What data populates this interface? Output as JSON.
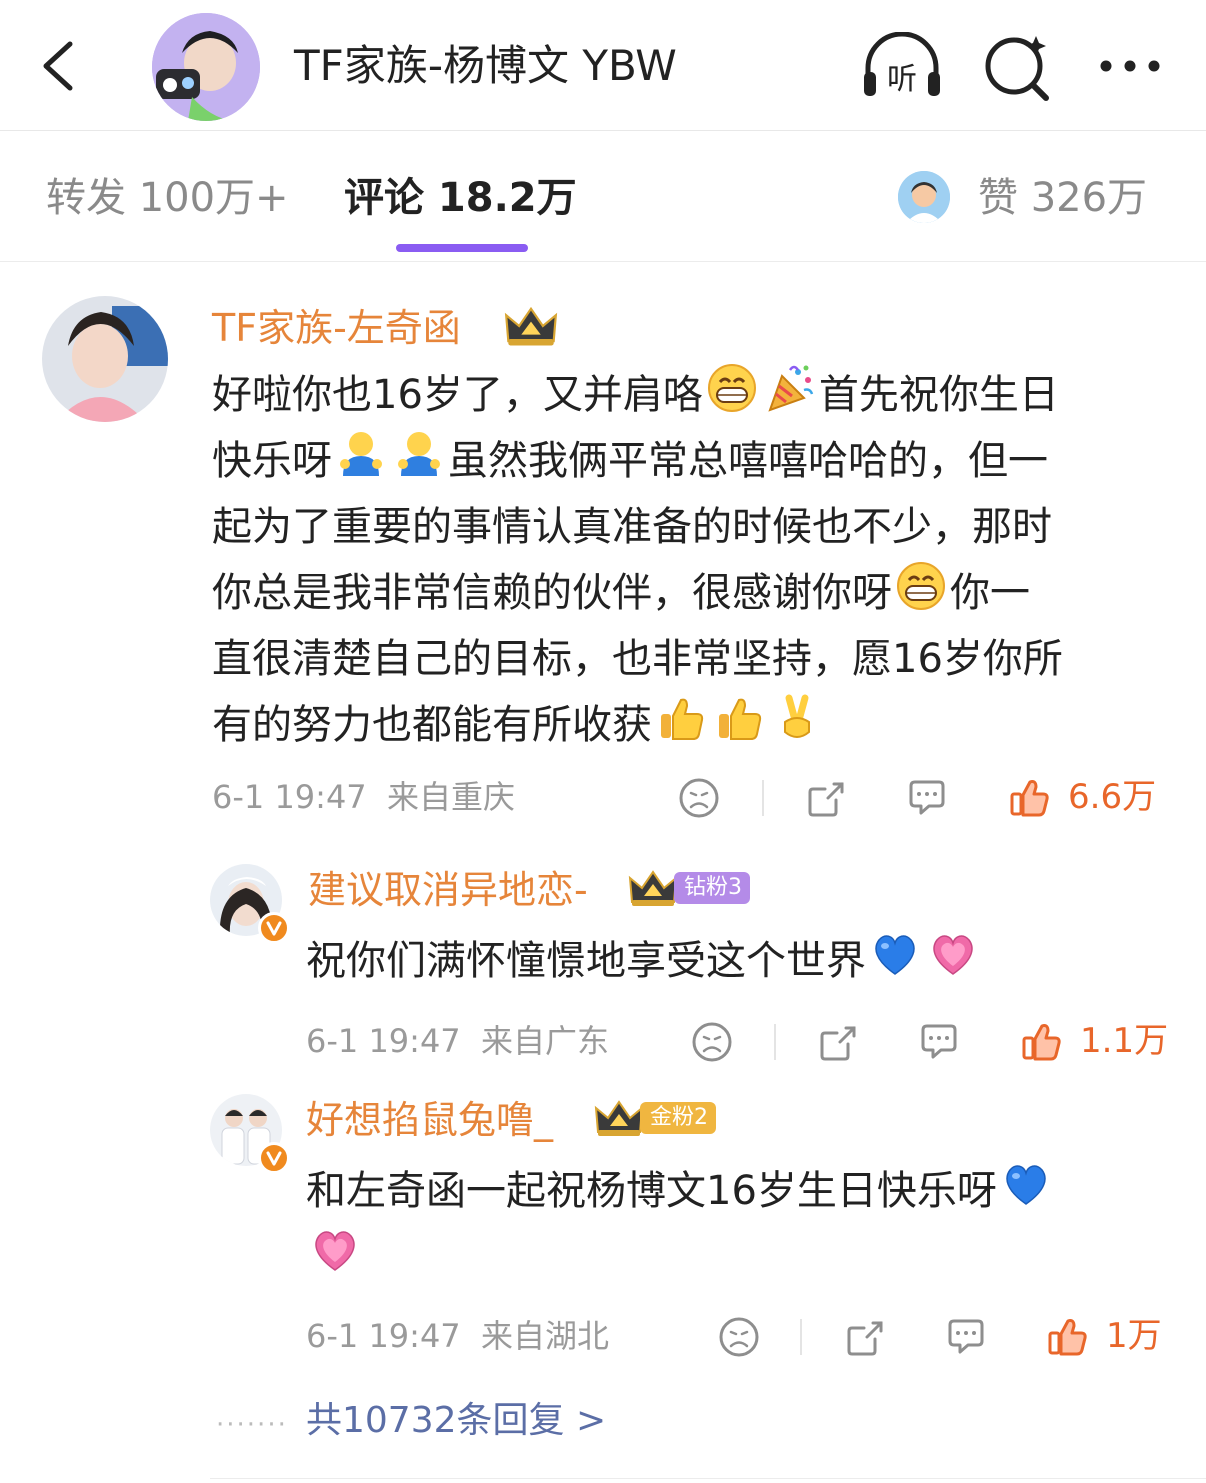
{
  "header": {
    "title": "TF家族-杨博文 YBW",
    "back_icon": "chevron-left-icon",
    "listen_label": "听",
    "search_icon": "search-sparkle-icon",
    "more_icon": "more-horizontal-icon"
  },
  "tabs": {
    "repost": "转发 100万+",
    "comments": "评论 18.2万",
    "likes": "赞 326万"
  },
  "comments": [
    {
      "username": "TF家族-左奇函",
      "lines": [
        "好啦你也16岁了，又并肩咯",
        "首先祝你生日",
        "快乐呀",
        "虽然我俩平常总嘻嘻哈哈的，但一",
        "起为了重要的事情认真准备的时候也不少，那时",
        "你总是我非常信赖的伙伴，很感谢你呀",
        "你一",
        "直很清楚自己的目标，也非常坚持，愿16岁你所",
        "有的努力也都能有所收获"
      ],
      "time": "6-1 19:47",
      "location": "来自重庆",
      "likes": "6.6万"
    },
    {
      "username": "建议取消异地恋-",
      "badge": "钻粉3",
      "text": "祝你们满怀憧憬地享受这个世界",
      "time": "6-1 19:47",
      "location": "来自广东",
      "likes": "1.1万"
    },
    {
      "username": "好想掐鼠兔噜_",
      "badge": "金粉2",
      "text": "和左奇函一起祝杨博文16岁生日快乐呀",
      "time": "6-1 19:47",
      "location": "来自湖北",
      "likes": "1万"
    }
  ],
  "more_replies": "共10732条回复 >",
  "dots": "·······",
  "colors": {
    "username": "#e6853a",
    "like": "#e8662a",
    "tab_indicator": "#8a5cf2",
    "reply_link": "#5b6ea6",
    "badge_diamond": "#b48be8",
    "badge_gold": "#f0b640"
  }
}
